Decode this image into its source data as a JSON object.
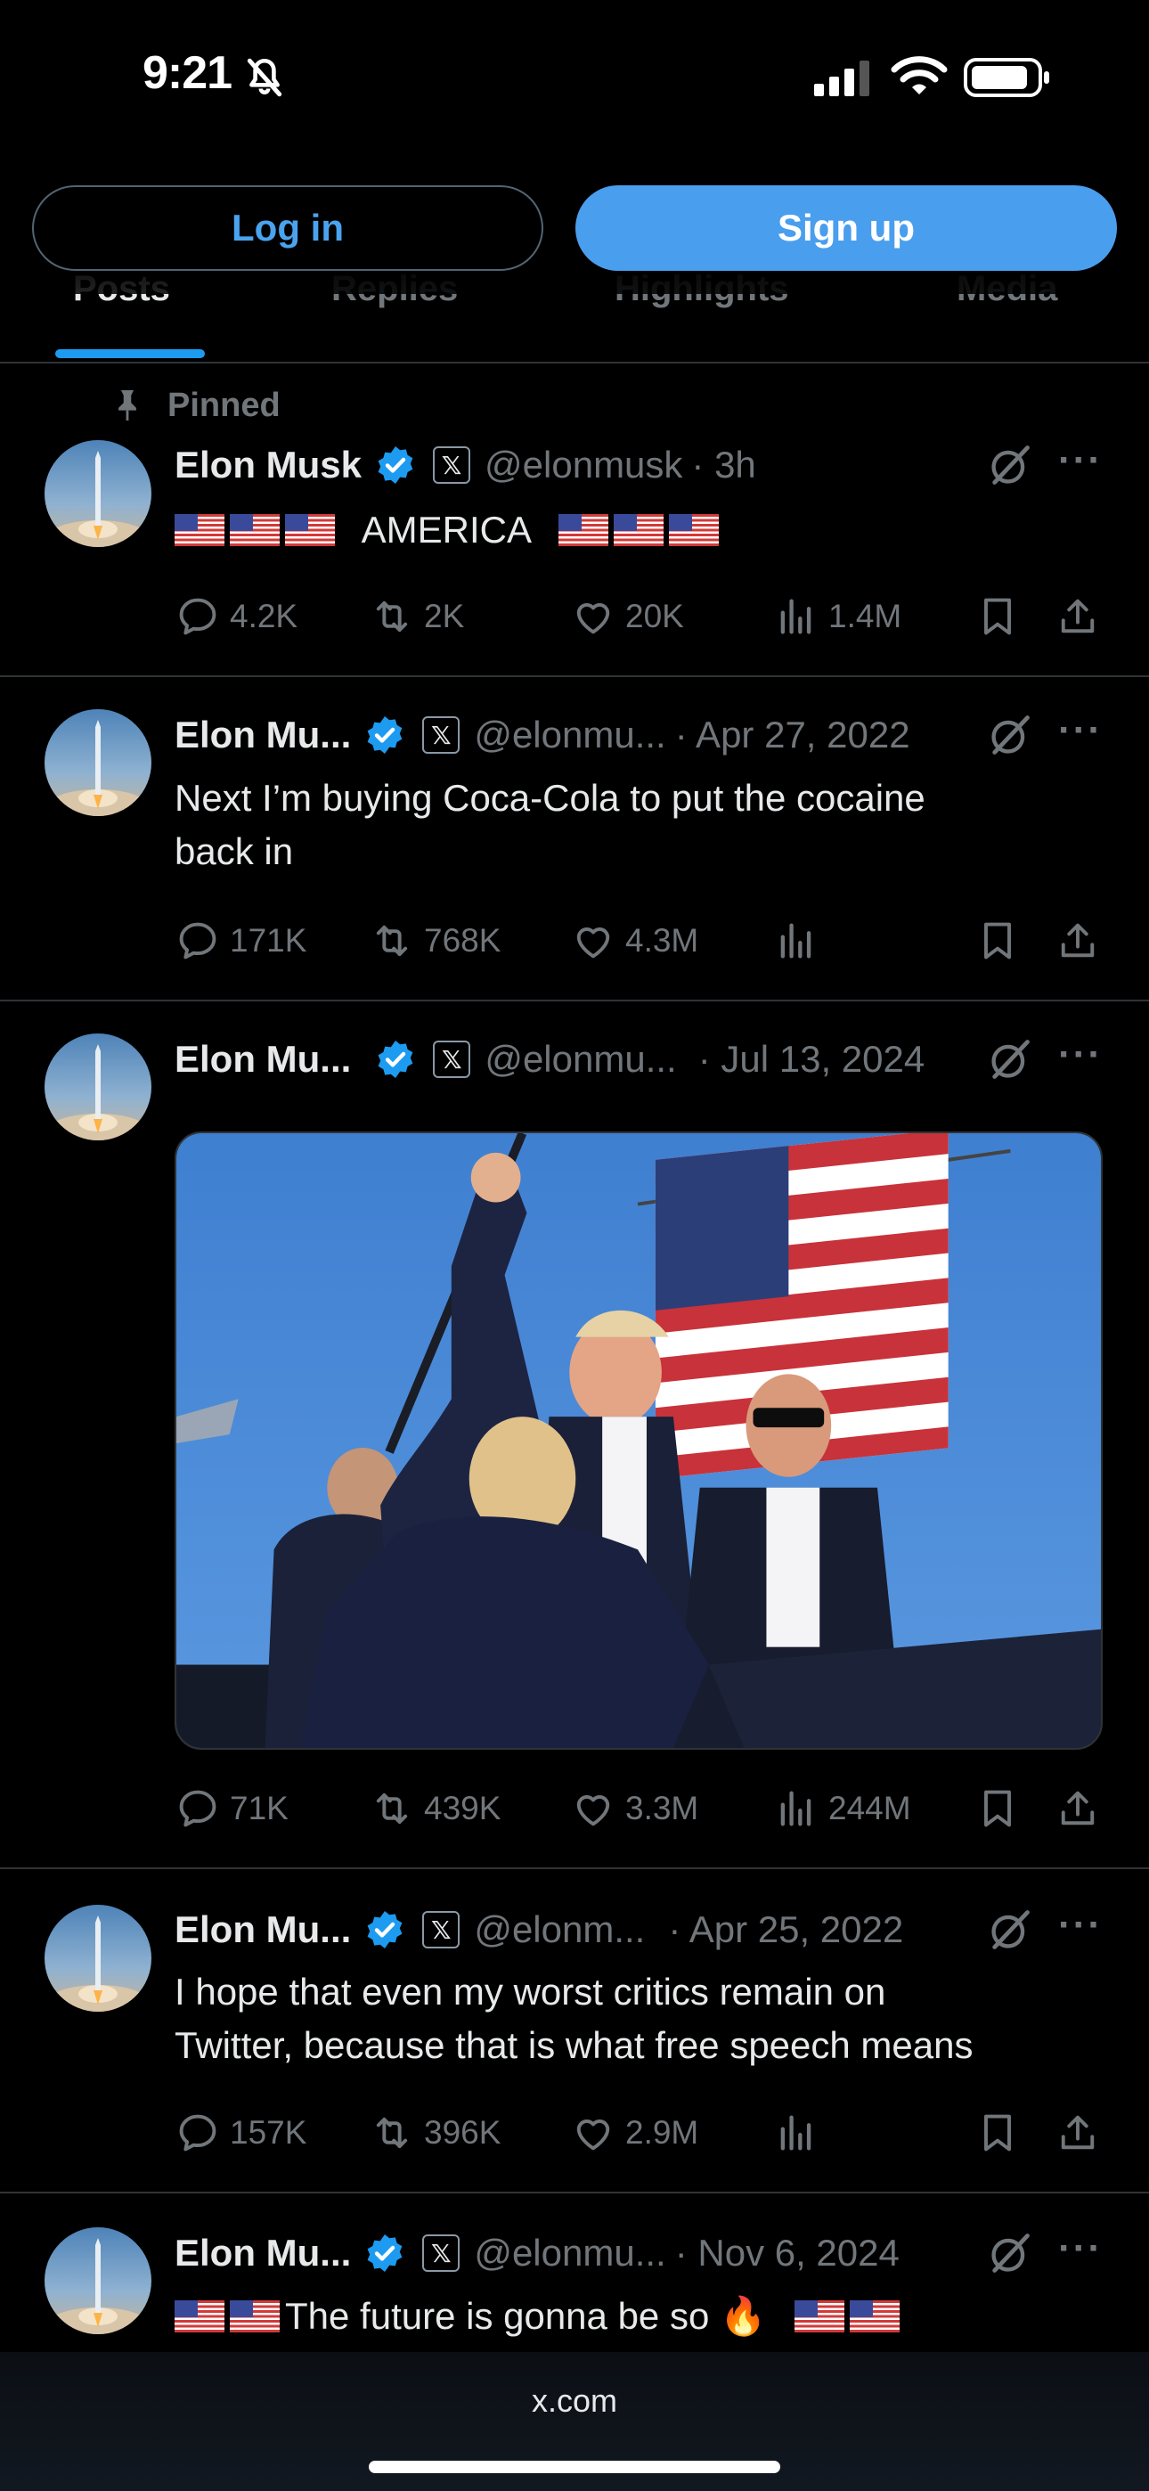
{
  "status": {
    "time": "9:21"
  },
  "tabs": [
    "Posts",
    "Replies",
    "Highlights",
    "Media"
  ],
  "buttons": {
    "login": "Log in",
    "signup": "Sign up"
  },
  "pinned_label": "Pinned",
  "posts": [
    {
      "name": "Elon Musk",
      "handle": "@elonmusk",
      "time": "· 3h",
      "text": "AMERICA",
      "replies": "4.2K",
      "reposts": "2K",
      "likes": "20K",
      "views": "1.4M"
    },
    {
      "name": "Elon Mu...",
      "handle": "@elonmu...",
      "time": "· Apr 27, 2022",
      "text_line1": "Next I’m buying Coca-Cola to put the cocaine",
      "text_line2": "back in",
      "replies": "171K",
      "reposts": "768K",
      "likes": "4.3M",
      "views": ""
    },
    {
      "name": "Elon Mu...",
      "handle": "@elonmu...",
      "time": "· Jul 13, 2024",
      "replies": "71K",
      "reposts": "439K",
      "likes": "3.3M",
      "views": "244M"
    },
    {
      "name": "Elon Mu...",
      "handle": "@elonm...",
      "time": "· Apr 25, 2022",
      "text_line1": "I hope that even my worst critics remain on",
      "text_line2": "Twitter, because that is what free speech means",
      "replies": "157K",
      "reposts": "396K",
      "likes": "2.9M",
      "views": ""
    },
    {
      "name": "Elon Mu...",
      "handle": "@elonmu...",
      "time": "· Nov 6, 2024",
      "text": "The future is gonna be so 🔥"
    }
  ],
  "browser": {
    "url": "x.com"
  },
  "colors": {
    "accent": "#1d9bf0",
    "signup": "#4a9eee",
    "muted": "#71767b"
  }
}
